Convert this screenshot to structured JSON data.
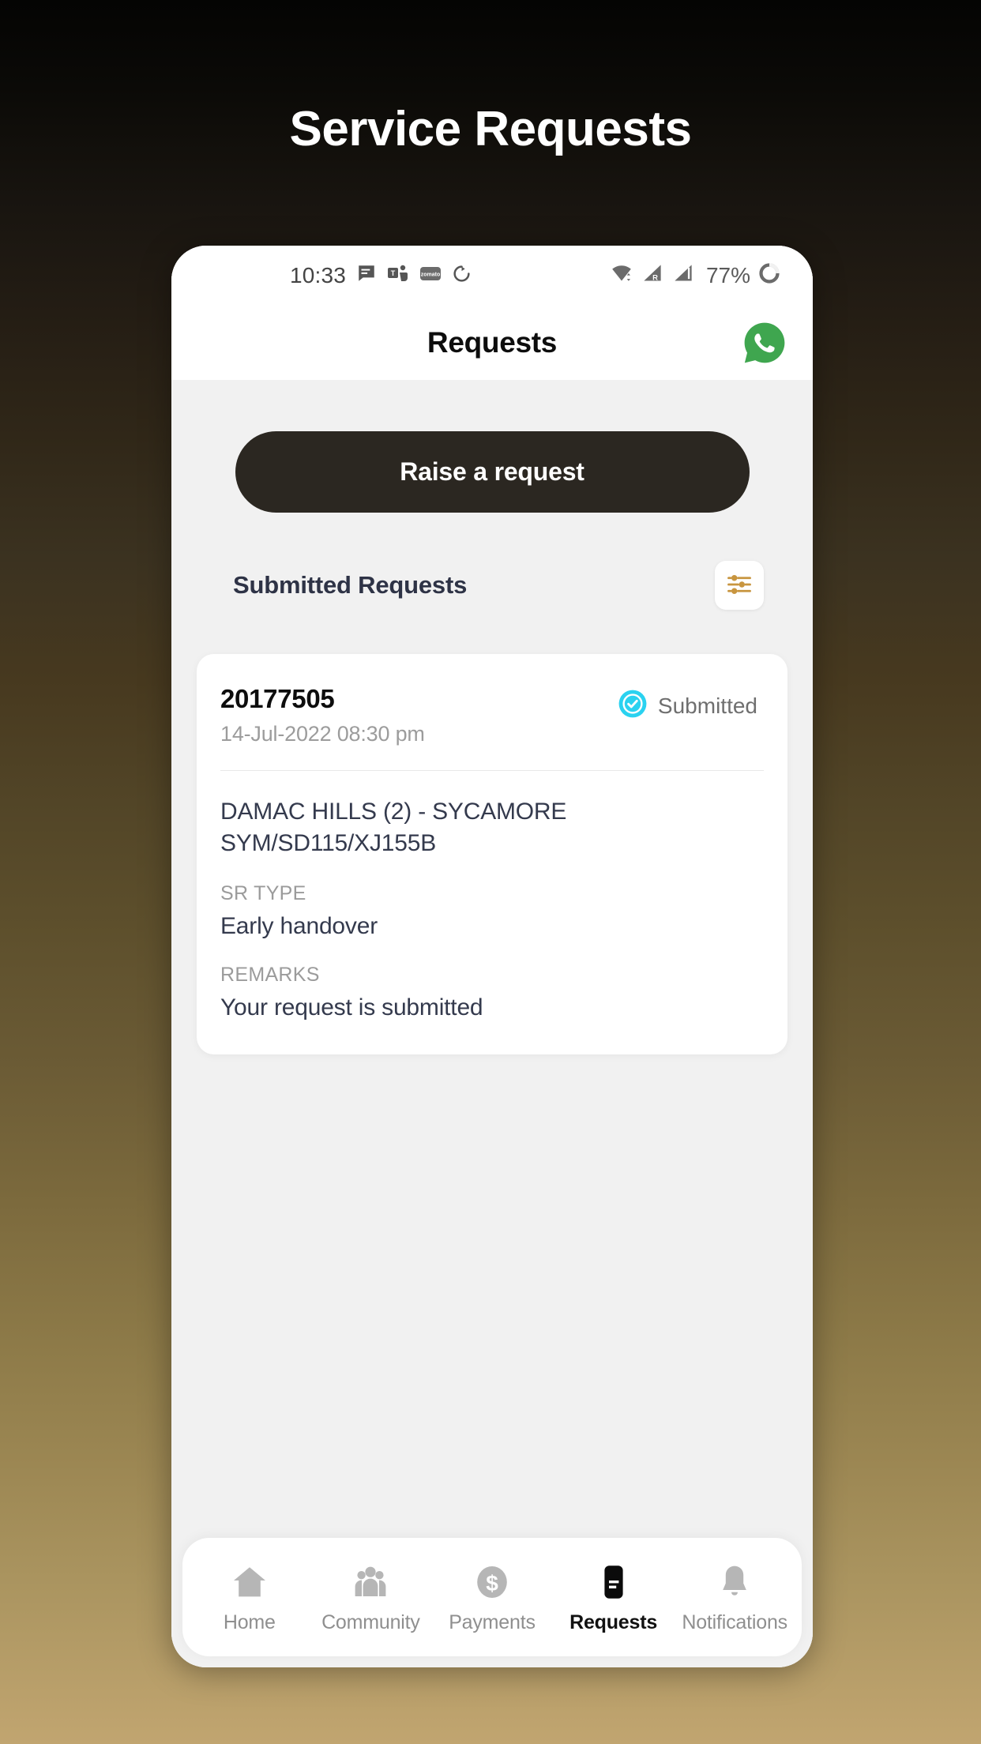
{
  "page": {
    "heading": "Service Requests"
  },
  "status_bar": {
    "time": "10:33",
    "battery_percent": "77%",
    "left_icons": [
      "messages-icon",
      "teams-icon",
      "zomato-icon",
      "sync-icon"
    ],
    "right_icons": [
      "wifi-icon",
      "signal-roaming-icon",
      "signal-icon",
      "battery-icon"
    ],
    "roaming_label": "R"
  },
  "app_bar": {
    "title": "Requests",
    "action_icon": "whatsapp-icon"
  },
  "main": {
    "raise_request_label": "Raise a request",
    "section_title": "Submitted Requests",
    "filter_icon": "filter-sliders-icon"
  },
  "request_card": {
    "id": "20177505",
    "date": "14-Jul-2022 08:30 pm",
    "status": "Submitted",
    "status_icon": "check-circle-icon",
    "property": "DAMAC HILLS (2) - SYCAMORE SYM/SD115/XJ155B",
    "sr_type_label": "SR TYPE",
    "sr_type_value": "Early handover",
    "remarks_label": "REMARKS",
    "remarks_value": "Your request is submitted"
  },
  "bottom_nav": {
    "items": [
      {
        "label": "Home",
        "icon": "home-icon",
        "active": false
      },
      {
        "label": "Community",
        "icon": "community-icon",
        "active": false
      },
      {
        "label": "Payments",
        "icon": "payments-icon",
        "active": false
      },
      {
        "label": "Requests",
        "icon": "requests-icon",
        "active": true
      },
      {
        "label": "Notifications",
        "icon": "notifications-icon",
        "active": false
      }
    ]
  },
  "colors": {
    "button_dark": "#2b2721",
    "accent_gold": "#c8953f",
    "status_cyan": "#2ad2f0",
    "whatsapp_green": "#3fa64f",
    "page_bg": "#f1f1f1",
    "text_dark": "#343a4d"
  }
}
